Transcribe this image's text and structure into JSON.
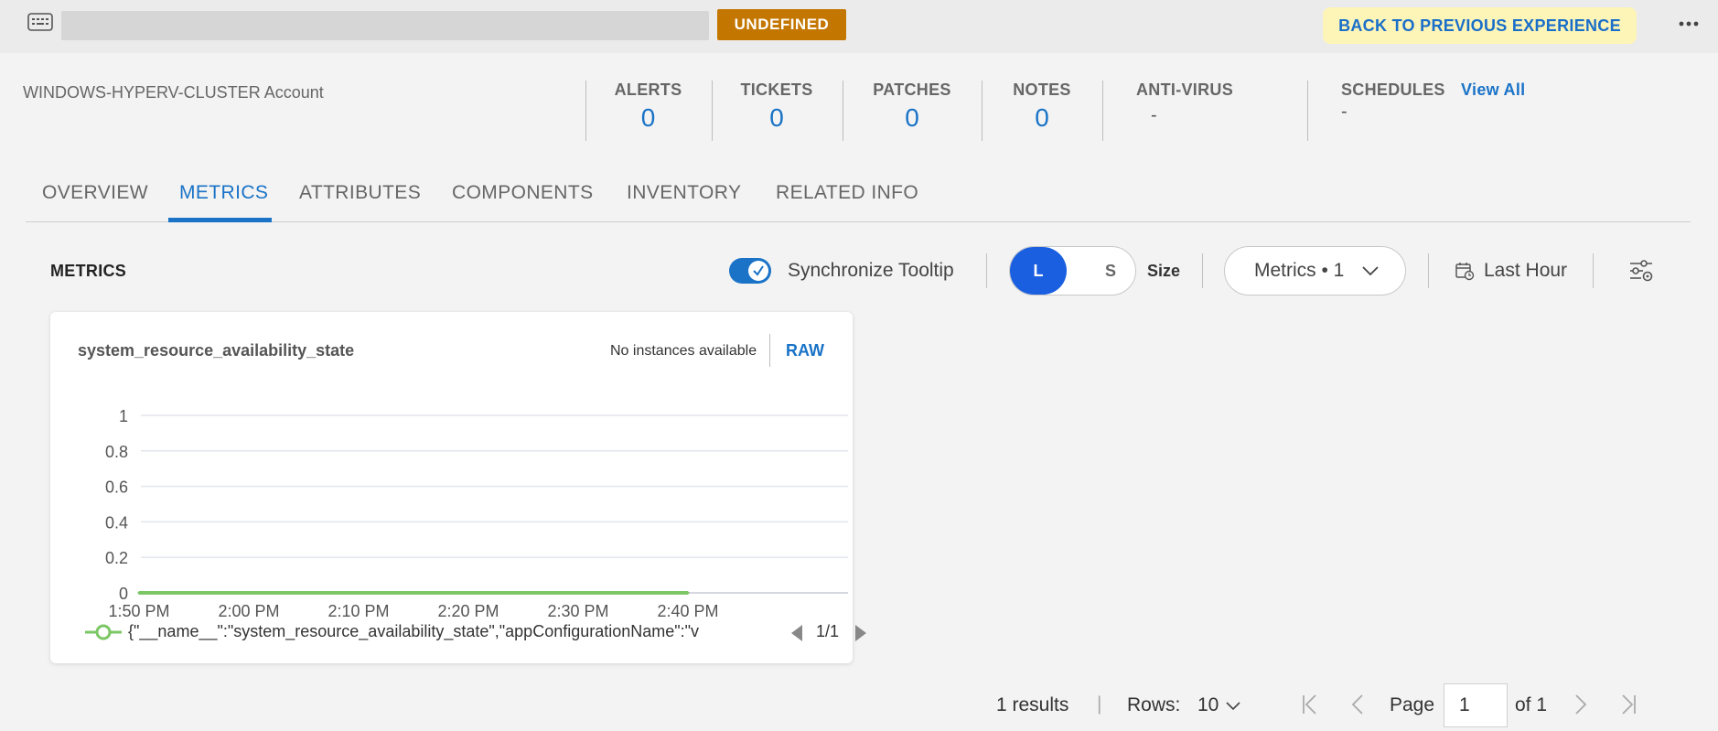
{
  "header": {
    "device_icon": "keyboard-device-icon",
    "status_badge": "UNDEFINED",
    "back_button": "BACK TO PREVIOUS EXPERIENCE",
    "more_icon": "more-horizontal-icon"
  },
  "account": {
    "title": "WINDOWS-HYPERV-CLUSTER Account"
  },
  "stats": {
    "alerts": {
      "label": "ALERTS",
      "value": "0"
    },
    "tickets": {
      "label": "TICKETS",
      "value": "0"
    },
    "patches": {
      "label": "PATCHES",
      "value": "0"
    },
    "notes": {
      "label": "NOTES",
      "value": "0"
    },
    "antivirus": {
      "label": "ANTI-VIRUS",
      "value": "-"
    },
    "schedules": {
      "label": "SCHEDULES",
      "value": "-",
      "link": "View All"
    }
  },
  "tabs": [
    {
      "label": "OVERVIEW",
      "active": false
    },
    {
      "label": "METRICS",
      "active": true
    },
    {
      "label": "ATTRIBUTES",
      "active": false
    },
    {
      "label": "COMPONENTS",
      "active": false
    },
    {
      "label": "INVENTORY",
      "active": false
    },
    {
      "label": "RELATED INFO",
      "active": false
    }
  ],
  "toolbar": {
    "section_title": "METRICS",
    "sync_tooltip_label": "Synchronize Tooltip",
    "sync_tooltip_on": true,
    "size_large": "L",
    "size_small": "S",
    "size_label": "Size",
    "size_selected": "L",
    "metrics_dropdown": "Metrics • 1",
    "time_range": "Last Hour",
    "filter_icon": "filter-settings-icon"
  },
  "metric_card": {
    "title": "system_resource_availability_state",
    "instances_note": "No instances available",
    "raw_button": "RAW",
    "legend_text": "{\"__name__\":\"system_resource_availability_state\",\"appConfigurationName\":\"v",
    "legend_page": "1/1",
    "series_color": "#7cc765"
  },
  "chart_data": {
    "type": "line",
    "title": "system_resource_availability_state",
    "xlabel": "",
    "ylabel": "",
    "ylim": [
      0,
      1
    ],
    "y_ticks": [
      "1",
      "0.8",
      "0.6",
      "0.4",
      "0.2",
      "0"
    ],
    "x_ticks": [
      "1:50 PM",
      "2:00 PM",
      "2:10 PM",
      "2:20 PM",
      "2:30 PM",
      "2:40 PM"
    ],
    "x_range": [
      "1:50 PM",
      "2:50 PM"
    ],
    "grid": true,
    "series": [
      {
        "values_x": [
          "1:50 PM",
          "2:00 PM",
          "2:10 PM",
          "2:20 PM",
          "2:30 PM",
          "2:40 PM"
        ],
        "values_y": [
          0,
          0,
          0,
          0,
          0,
          0
        ],
        "color": "#7cc765"
      }
    ]
  },
  "pagination": {
    "results": "1 results",
    "separator": "|",
    "rows_label": "Rows:",
    "rows_value": "10",
    "page_label": "Page",
    "page_value": "1",
    "of_label": "of 1"
  }
}
